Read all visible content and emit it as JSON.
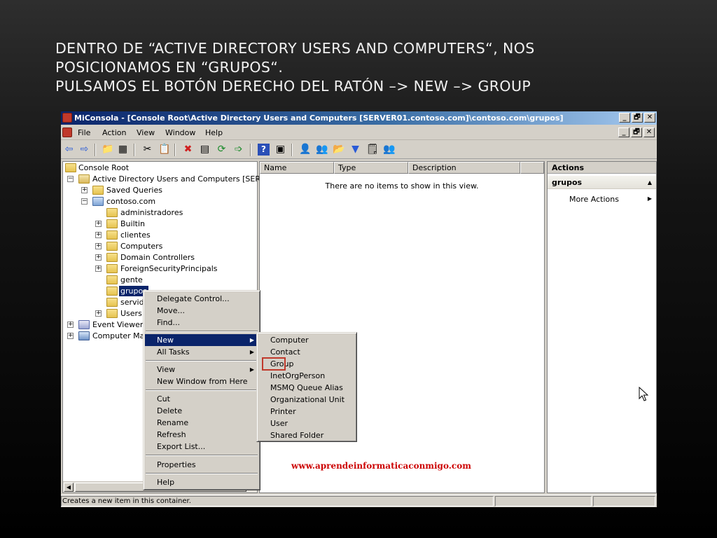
{
  "slide": {
    "line1": "DENTRO DE “ACTIVE DIRECTORY USERS AND COMPUTERS“, NOS",
    "line2": "POSICIONAMOS EN “GRUPOS“.",
    "line3": "PULSAMOS EL BOTÓN DERECHO DEL RATÓN –> NEW –> GROUP"
  },
  "window": {
    "title": "MiConsola - [Console Root\\Active Directory Users and Computers [SERVER01.contoso.com]\\contoso.com\\grupos]",
    "btn_min": "_",
    "btn_restore": "🗗",
    "btn_close": "✕"
  },
  "menu": {
    "file": "File",
    "action": "Action",
    "view": "View",
    "window": "Window",
    "help": "Help"
  },
  "toolbar": {
    "back": "⇦",
    "forward": "⇨",
    "up": "📁",
    "props": "▦",
    "cut": "✂",
    "copy": "📋",
    "delete": "✖",
    "export": "▤",
    "refresh": "⟳",
    "export2": "➩",
    "help": "?",
    "pane": "▣",
    "user": "👤",
    "users": "👥",
    "ou": "📂",
    "filter": "▼",
    "find": "🗒",
    "delegate": "👥"
  },
  "tree": {
    "root": "Console Root",
    "aduc": "Active Directory Users and Computers [SERV",
    "saved": "Saved Queries",
    "domain": "contoso.com",
    "administradores": "administradores",
    "builtin": "Builtin",
    "clientes": "clientes",
    "computers": "Computers",
    "dc": "Domain Controllers",
    "fsp": "ForeignSecurityPrincipals",
    "gente": "gente",
    "grupos": "grupos",
    "servid": "servid",
    "users": "Users",
    "event": "Event Viewer",
    "compmgmt": "Computer Mar",
    "plus": "+",
    "minus": "−"
  },
  "list": {
    "col_name": "Name",
    "col_type": "Type",
    "col_desc": "Description",
    "empty": "There are no items to show in this view.",
    "watermark": "www.aprendeinformaticaconmigo.com"
  },
  "actions": {
    "header": "Actions",
    "section": "grupos",
    "section_caret": "▲",
    "more": "More Actions",
    "more_arrow": "▶"
  },
  "context_menu": {
    "delegate": "Delegate Control...",
    "move": "Move...",
    "find": "Find...",
    "new": "New",
    "all_tasks": "All Tasks",
    "view": "View",
    "new_window": "New Window from Here",
    "cut": "Cut",
    "delete": "Delete",
    "rename": "Rename",
    "refresh": "Refresh",
    "export": "Export List...",
    "properties": "Properties",
    "help": "Help",
    "sub_arrow": "▶"
  },
  "submenu": {
    "computer": "Computer",
    "contact": "Contact",
    "group": "Group",
    "inetorgperson": "InetOrgPerson",
    "msmq": "MSMQ Queue Alias",
    "ou": "Organizational Unit",
    "printer": "Printer",
    "user": "User",
    "shared": "Shared Folder"
  },
  "status": {
    "text": "Creates a new item in this container."
  },
  "scroll": {
    "left": "◀"
  }
}
